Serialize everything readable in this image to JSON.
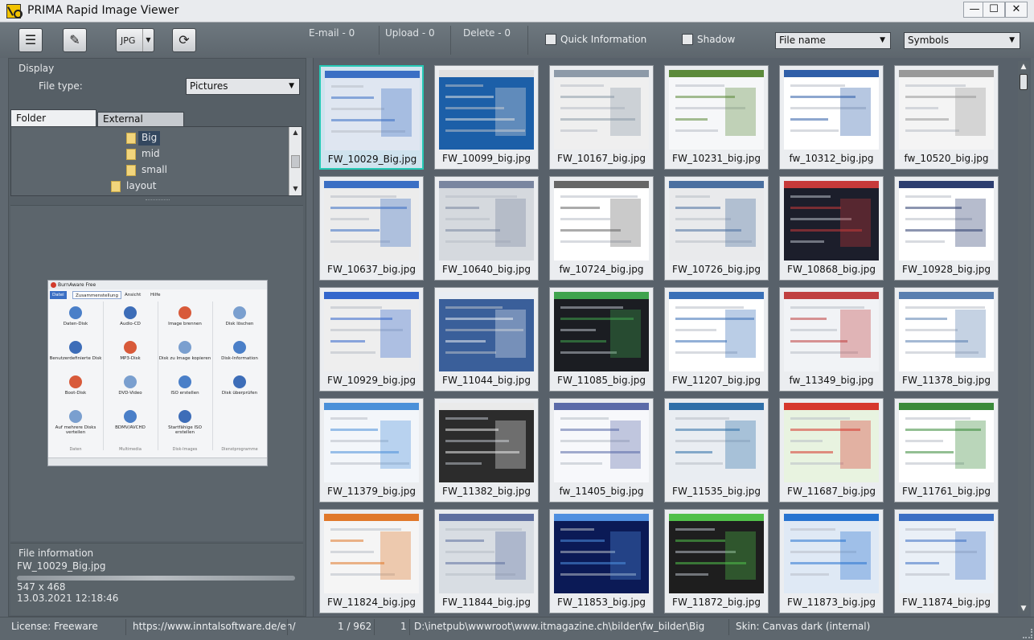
{
  "window": {
    "title": "PRIMA Rapid Image Viewer",
    "min": "—",
    "max": "☐",
    "close": "✕"
  },
  "toolbar": {
    "format_label": "JPG",
    "counters": {
      "email": "E-mail - 0",
      "upload": "Upload - 0",
      "delete": "Delete - 0"
    },
    "quick_info": "Quick Information",
    "shadow": "Shadow",
    "sort_by": "File name",
    "view_mode": "Symbols"
  },
  "left": {
    "display_label": "Display",
    "file_type_label": "File type:",
    "file_type_value": "Pictures",
    "tabs": [
      "Folder structure",
      "External devices"
    ],
    "tree": [
      {
        "label": "Big",
        "selected": true
      },
      {
        "label": "mid"
      },
      {
        "label": "small"
      },
      {
        "label": "layout"
      }
    ],
    "preview": {
      "title": "BurnAware Free",
      "tabs": [
        "Datei",
        "Zusammenstellung",
        "Ansicht",
        "Hilfe"
      ],
      "items": [
        [
          "Daten-Disk",
          "Audio-CD",
          "Image brennen",
          "Disk löschen"
        ],
        [
          "Benutzerdefinierte Disk",
          "MP3-Disk",
          "Disk zu Image kopieren",
          "Disk-Information"
        ],
        [
          "Boot-Disk",
          "DVD-Video",
          "ISO erstellen",
          "Disk überprüfen"
        ],
        [
          "Auf mehrere Disks verteilen",
          "BDMV/AVCHD",
          "Startfähige ISO erstellen",
          ""
        ]
      ],
      "groups": [
        "Daten",
        "Multimedia",
        "Disk-Images",
        "Dienstprogramme"
      ]
    },
    "file_info": {
      "label": "File information",
      "name": "FW_10029_Big.jpg",
      "dimensions": "547 x 468",
      "date": "13.03.2021 12:18:46"
    }
  },
  "gallery": {
    "thumbnails": [
      "FW_10029_Big.jpg",
      "FW_10099_big.jpg",
      "FW_10167_big.jpg",
      "FW_10231_big.jpg",
      "fw_10312_big.jpg",
      "fw_10520_big.jpg",
      "FW_10637_big.jpg",
      "FW_10640_big.jpg",
      "fw_10724_big.jpg",
      "FW_10726_big.jpg",
      "FW_10868_big.jpg",
      "FW_10928_big.jpg",
      "FW_10929_big.jpg",
      "FW_11044_big.jpg",
      "FW_11085_big.jpg",
      "FW_11207_big.jpg",
      "fw_11349_big.jpg",
      "FW_11378_big.jpg",
      "FW_11379_big.jpg",
      "FW_11382_big.jpg",
      "fw_11405_big.jpg",
      "FW_11535_big.jpg",
      "FW_11687_big.jpg",
      "FW_11761_big.jpg",
      "FW_11824_big.jpg",
      "FW_11844_big.jpg",
      "FW_11853_big.jpg",
      "FW_11872_big.jpg",
      "FW_11873_big.jpg",
      "FW_11874_big.jpg"
    ],
    "selected_index": 0
  },
  "status": {
    "license": "License: Freeware",
    "url": "https://www.inntalsoftware.de/en/",
    "position": "1 / 962",
    "selected_count": "1",
    "path": "D:\\inetpub\\wwwroot\\www.itmagazine.ch\\bilder\\fw_bilder\\Big",
    "skin": "Skin: Canvas dark (internal)"
  },
  "colors": {
    "selection_border": "#26c9b6",
    "panel_bg": "#565f66",
    "window_bg": "#5f6870"
  }
}
